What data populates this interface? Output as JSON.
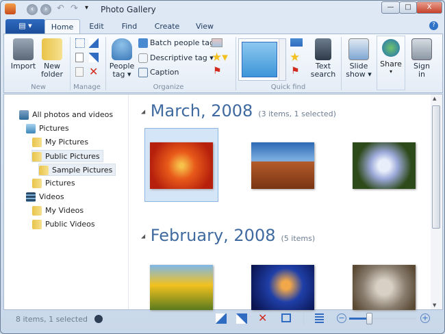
{
  "window": {
    "title": "Photo Gallery",
    "minimize": "—",
    "maximize": "□",
    "close": "X"
  },
  "qat": {
    "back": "‹",
    "forward": "›",
    "undo": "↶",
    "redo": "↷",
    "customize": "▾"
  },
  "tabs": {
    "file": "▤ ▾",
    "items": [
      "Home",
      "Edit",
      "Find",
      "Create",
      "View"
    ],
    "help": "?"
  },
  "ribbon": {
    "new": {
      "label": "New",
      "import": "Import",
      "new_folder_1": "New",
      "new_folder_2": "folder"
    },
    "manage": {
      "label": "Manage"
    },
    "organize": {
      "label": "Organize",
      "people_tag_1": "People",
      "people_tag_2": "tag ▾",
      "batch": "Batch people tag",
      "descriptive": "Descriptive tag ▾",
      "caption": "Caption"
    },
    "quick_find": {
      "label": "Quick find",
      "text_search_1": "Text",
      "text_search_2": "search"
    },
    "slide_show_1": "Slide",
    "slide_show_2": "show ▾",
    "share": "Share",
    "share_arrow": "▾",
    "sign_in_1": "Sign",
    "sign_in_2": "in"
  },
  "nav": [
    {
      "label": "All photos and videos"
    },
    {
      "label": "Pictures"
    },
    {
      "label": "My Pictures"
    },
    {
      "label": "Public Pictures"
    },
    {
      "label": "Sample Pictures"
    },
    {
      "label": "Pictures"
    },
    {
      "label": "Videos"
    },
    {
      "label": "My Videos"
    },
    {
      "label": "Public Videos"
    }
  ],
  "groups": [
    {
      "title": "March, 2008",
      "count": "(3 items, 1 selected)"
    },
    {
      "title": "February, 2008",
      "count": "(5 items)"
    }
  ],
  "status": {
    "text": "8 items, 1 selected",
    "zoom_minus": "−",
    "zoom_plus": "+",
    "zoom_level": 0.3
  }
}
